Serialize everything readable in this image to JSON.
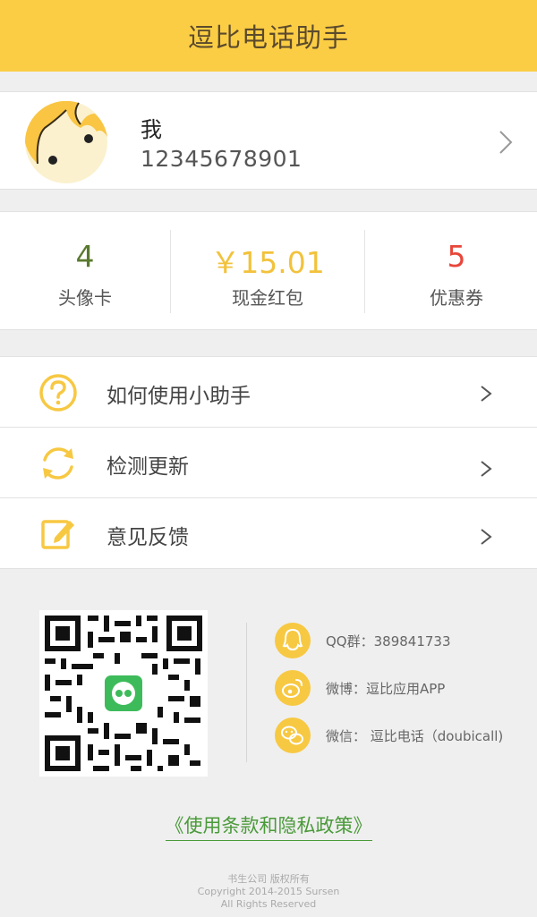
{
  "header": {
    "title": "逗比电话助手"
  },
  "profile": {
    "name": "我",
    "phone": "12345678901"
  },
  "stats": [
    {
      "value": "4",
      "label": "头像卡",
      "color": "#5a7a2e"
    },
    {
      "value": "￥15.01",
      "label": "现金红包",
      "color": "#f2c23b"
    },
    {
      "value": "5",
      "label": "优惠券",
      "color": "#e8463a"
    }
  ],
  "menu": [
    {
      "label": "如何使用小助手",
      "icon": "help-circle-icon"
    },
    {
      "label": "检测更新",
      "icon": "refresh-icon"
    },
    {
      "label": "意见反馈",
      "icon": "edit-icon"
    }
  ],
  "contacts": [
    {
      "text": "QQ群：389841733",
      "icon": "qq-icon"
    },
    {
      "text": "微博：逗比应用APP",
      "icon": "weibo-icon"
    },
    {
      "text": "微信： 逗比电话（doubicall)",
      "icon": "wechat-icon"
    }
  ],
  "terms": {
    "label": "《使用条款和隐私政策》"
  },
  "footer": {
    "line1": "书生公司  版权所有",
    "line2": "Copyright  2014-2015  Sursen",
    "line3": "All  Rights  Reserved"
  },
  "colors": {
    "header_bg": "#fbcd45",
    "accent": "#f7c842",
    "link": "#4a9a3a"
  }
}
